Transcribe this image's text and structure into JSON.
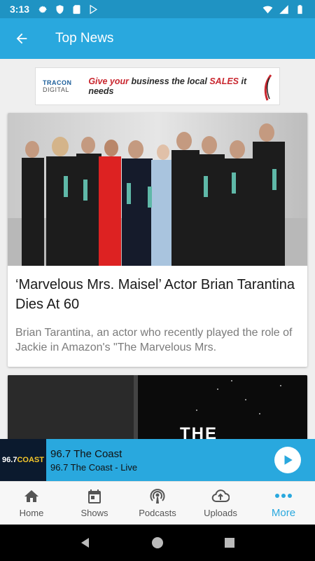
{
  "status_bar": {
    "time": "3:13",
    "icons": [
      "settings-icon",
      "shield-icon",
      "sd-card-icon",
      "play-store-icon",
      "wifi-icon",
      "cell-signal-icon",
      "battery-icon"
    ]
  },
  "app_bar": {
    "title": "Top News",
    "back_icon": "arrow-back-icon"
  },
  "ad": {
    "brand_part1": "TRACON",
    "brand_part2": " DIGITAL",
    "text_red1": "Give your",
    "text_dark1": " business the local ",
    "text_red2": "SALES",
    "text_dark2": " it needs"
  },
  "articles": [
    {
      "headline": "‘Marvelous Mrs. Maisel’ Actor Brian Tarantina Dies At 60",
      "summary": "Brian Tarantina, an actor who recently played the role of Jackie in Amazon's \"The Marvelous Mrs."
    },
    {
      "image_text": "THE"
    }
  ],
  "player": {
    "logo_num": "96.7",
    "logo_text": "COAST",
    "station": "96.7 The Coast",
    "subtitle": "96.7 The Coast - Live"
  },
  "bottom_nav": {
    "items": [
      {
        "label": "Home",
        "icon": "home-icon"
      },
      {
        "label": "Shows",
        "icon": "calendar-icon"
      },
      {
        "label": "Podcasts",
        "icon": "podcast-icon"
      },
      {
        "label": "Uploads",
        "icon": "cloud-upload-icon"
      },
      {
        "label": "More",
        "icon": "more-dots-icon"
      }
    ],
    "active_index": 4
  },
  "colors": {
    "status_bar": "#1f93c3",
    "app_bar": "#29a8de",
    "accent": "#29a8de"
  }
}
